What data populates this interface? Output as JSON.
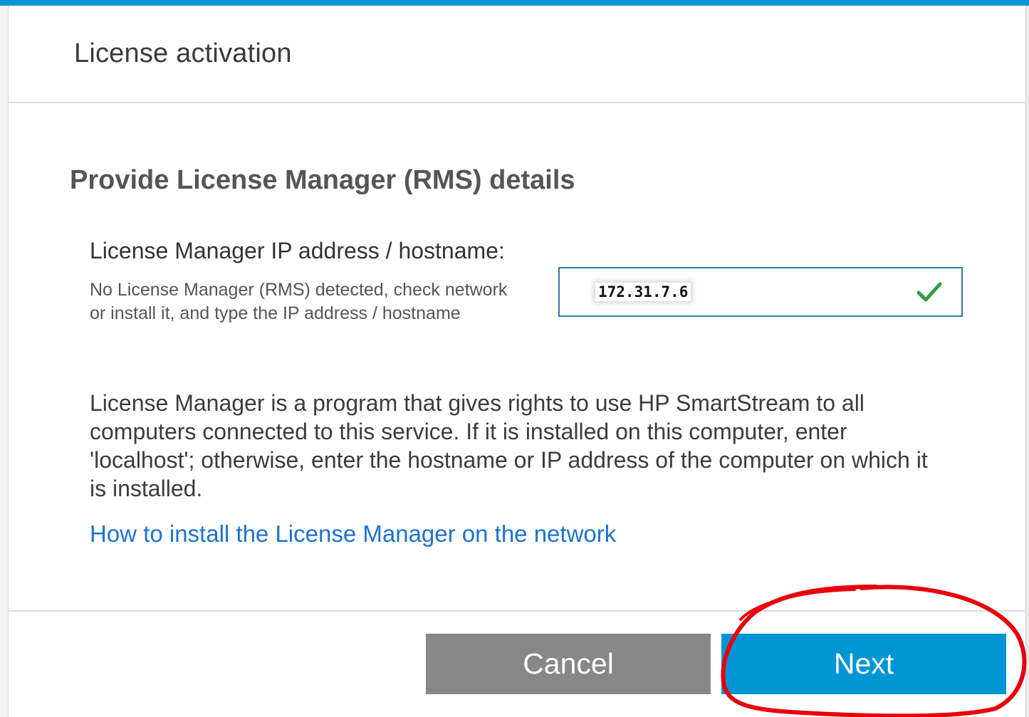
{
  "dialog": {
    "title": "License activation",
    "accent_color": "#0096d6"
  },
  "section": {
    "heading": "Provide License Manager (RMS) details"
  },
  "ip_field": {
    "label": "License Manager IP address / hostname:",
    "help_text": "No License Manager (RMS) detected, check network or install it, and type the IP address / hostname",
    "value": "172.31.7.6",
    "status_icon": "check-icon",
    "status_color": "#2e9e44"
  },
  "description": "License Manager is a program that gives rights to use HP SmartStream to all computers connected to this service. If it is installed on this computer, enter 'localhost'; otherwise, enter the hostname or IP address of the computer on which it is installed.",
  "help_link": "How to install the License Manager on the network",
  "buttons": {
    "cancel_label": "Cancel",
    "next_label": "Next"
  },
  "annotation": {
    "shape": "freehand-circle",
    "color": "#e8000b",
    "target": "next-button"
  }
}
